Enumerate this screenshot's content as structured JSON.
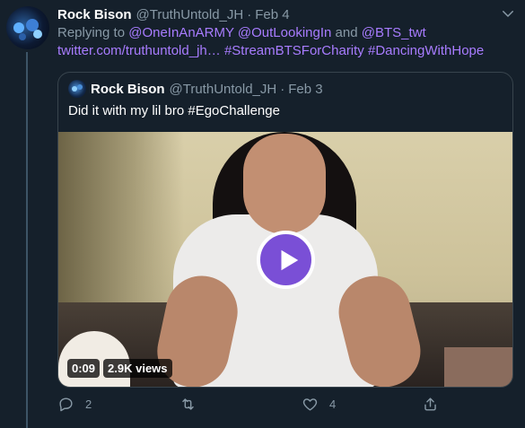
{
  "tweet": {
    "author_name": "Rock Bison",
    "author_handle": "@TruthUntold_JH",
    "separator": "·",
    "date": "Feb 4",
    "replying_prefix": "Replying to",
    "mention_1": "@OneInAnARMY",
    "mention_2": "@OutLookingIn",
    "and_word": "and",
    "mention_3": "@BTS_twt",
    "link_text": "twitter.com/truthuntold_jh…",
    "hashtag_1": "#StreamBTSForCharity",
    "hashtag_2": "#DancingWithHope"
  },
  "quoted_tweet": {
    "author_name": "Rock Bison",
    "author_handle": "@TruthUntold_JH",
    "separator": "·",
    "date": "Feb 3",
    "text": "Did it with my lil bro #EgoChallenge",
    "video": {
      "duration": "0:09",
      "views": "2.9K views"
    }
  },
  "actions": {
    "reply_count": "2",
    "retweet_count": "",
    "like_count": "4"
  },
  "icons": {
    "more": "chevron-down-icon",
    "play": "play-icon",
    "reply": "reply-icon",
    "retweet": "retweet-icon",
    "like": "heart-icon",
    "share": "share-icon"
  },
  "colors": {
    "background": "#15202b",
    "link": "#1da1f2",
    "hashtag_purple": "#a87cff",
    "muted": "#8899a6",
    "play_button": "#7a4fd6"
  }
}
